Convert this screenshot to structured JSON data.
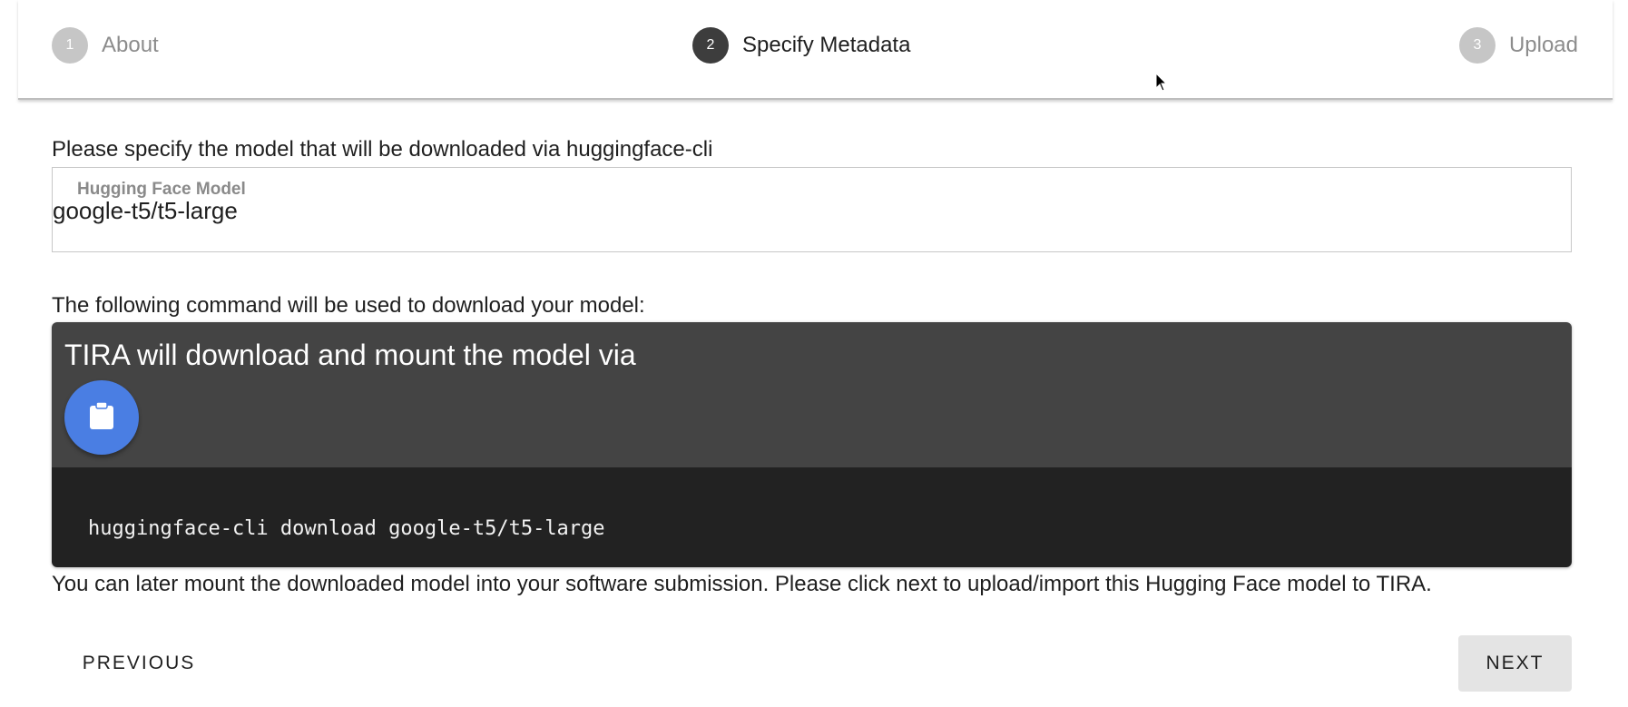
{
  "stepper": {
    "steps": [
      {
        "number": "1",
        "label": "About"
      },
      {
        "number": "2",
        "label": "Specify Metadata"
      },
      {
        "number": "3",
        "label": "Upload"
      }
    ],
    "active_step": 2
  },
  "model_section": {
    "instruction": "Please specify the model that will be downloaded via huggingface-cli",
    "field_label": "Hugging Face Model",
    "field_value": "google-t5/t5-large"
  },
  "command_section": {
    "intro": "The following command will be used to download your model:",
    "card_title": "TIRA will download and mount the model via",
    "copy_button_icon": "clipboard-icon",
    "command": "huggingface-cli download google-t5/t5-large"
  },
  "footer_note": "You can later mount the downloaded model into your software submission. Please click next to upload/import this Hugging Face model to TIRA.",
  "buttons": {
    "previous": "PREVIOUS",
    "next": "NEXT"
  },
  "colors": {
    "active_step": "#3d3d3d",
    "inactive_step": "#c6c6c6",
    "card_header": "#444444",
    "card_body": "#222222",
    "copy_button": "#4a7ee3"
  }
}
